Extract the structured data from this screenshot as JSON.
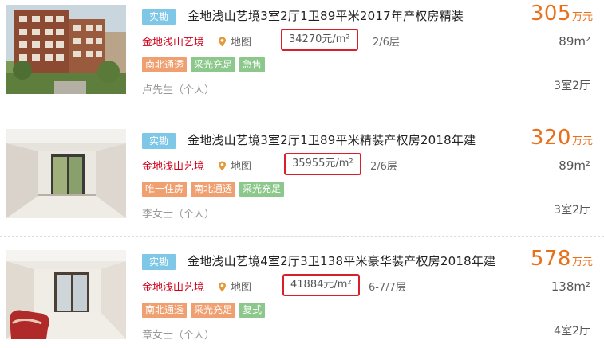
{
  "listings": [
    {
      "verified": "实勘",
      "title": "金地浅山艺境3室2厅1卫89平米2017年产权房精装",
      "community": "金地浅山艺境",
      "map": "地图",
      "unit_price": "34270元/m²",
      "floor": "2/6层",
      "tags": [
        {
          "label": "南北通透",
          "color": "orange"
        },
        {
          "label": "采光充足",
          "color": "green"
        },
        {
          "label": "急售",
          "color": "green"
        }
      ],
      "agent": "卢先生（个人）",
      "price": "305",
      "price_unit": "万元",
      "area": "89m²",
      "layout": "3室2厅"
    },
    {
      "verified": "实勘",
      "title": "金地浅山艺境3室2厅1卫89平米精装产权房2018年建",
      "community": "金地浅山艺境",
      "map": "地图",
      "unit_price": "35955元/m²",
      "floor": "2/6层",
      "tags": [
        {
          "label": "唯一住房",
          "color": "orange"
        },
        {
          "label": "南北通透",
          "color": "orange"
        },
        {
          "label": "采光充足",
          "color": "green"
        }
      ],
      "agent": "李女士（个人）",
      "price": "320",
      "price_unit": "万元",
      "area": "89m²",
      "layout": "3室2厅"
    },
    {
      "verified": "实勘",
      "title": "金地浅山艺境4室2厅3卫138平米豪华装产权房2018年建",
      "community": "金地浅山艺境",
      "map": "地图",
      "unit_price": "41884元/m²",
      "floor": "6-7/7层",
      "tags": [
        {
          "label": "南北通透",
          "color": "orange"
        },
        {
          "label": "采光充足",
          "color": "orange"
        },
        {
          "label": "复式",
          "color": "green"
        }
      ],
      "agent": "章女士（个人）",
      "price": "578",
      "price_unit": "万元",
      "area": "138m²",
      "layout": "4室2厅"
    }
  ],
  "colors": {
    "verified_tag": "#7fc7e6",
    "community_link": "#d0021b",
    "highlight_box": "#d9202a",
    "price": "#e8701a",
    "tag_orange": "#f0a070",
    "tag_green": "#8cc88c"
  },
  "icons": {
    "map": "map-pin-icon",
    "photo_1": "building-exterior-photo",
    "photo_2": "empty-room-photo",
    "photo_3": "living-room-photo"
  }
}
